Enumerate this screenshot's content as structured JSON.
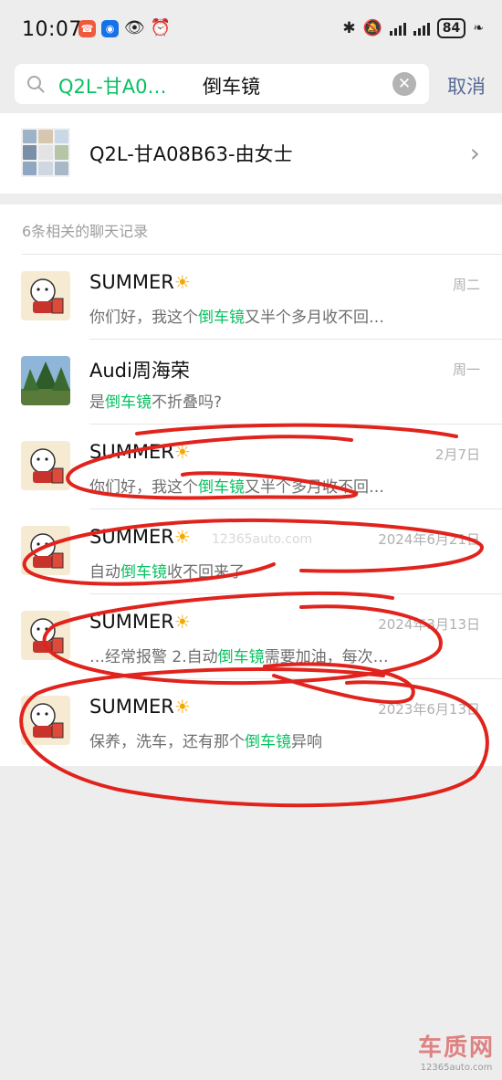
{
  "status_bar": {
    "time": "10:07",
    "battery": "84",
    "icons": [
      "missed-call-icon",
      "app-icon",
      "eye-icon",
      "alarm-icon",
      "bluetooth-icon",
      "mute-icon",
      "signal-icon",
      "battery-icon",
      "leaf-icon"
    ]
  },
  "search": {
    "tag": "Q2L-甘A0…",
    "keyword": "倒车镜",
    "cancel_label": "取消"
  },
  "contact": {
    "name": "Q2L-甘A08B63-由女士"
  },
  "records": {
    "section_label": "6条相关的聊天记录",
    "items": [
      {
        "name": "SUMMER",
        "time": "周二",
        "pre": "你们好，我这个",
        "hl": "倒车镜",
        "post": "又半个多月收不回…"
      },
      {
        "name": "Audi周海荣",
        "time": "周一",
        "pre": "是",
        "hl": "倒车镜",
        "post": "不折叠吗?"
      },
      {
        "name": "SUMMER",
        "time": "2月7日",
        "pre": "你们好，我这个",
        "hl": "倒车镜",
        "post": "又半个多月收不回…"
      },
      {
        "name": "SUMMER",
        "time": "2024年6月21日",
        "pre": "自动",
        "hl": "倒车镜",
        "post": "收不回来了"
      },
      {
        "name": "SUMMER",
        "time": "2024年3月13日",
        "pre": "…经常报警 2.自动",
        "hl": "倒车镜",
        "post": "需要加油，每次…"
      },
      {
        "name": "SUMMER",
        "time": "2023年6月13日",
        "pre": "保养，洗车，还有那个",
        "hl": "倒车镜",
        "post": "异响"
      }
    ]
  },
  "watermark": "12365auto.com",
  "brand": {
    "name": "车质网",
    "url": "12365auto.com"
  },
  "colors": {
    "accent_green": "#07c160",
    "link_blue": "#576b95",
    "annotation_red": "#e0231c",
    "background": "#ededed"
  }
}
